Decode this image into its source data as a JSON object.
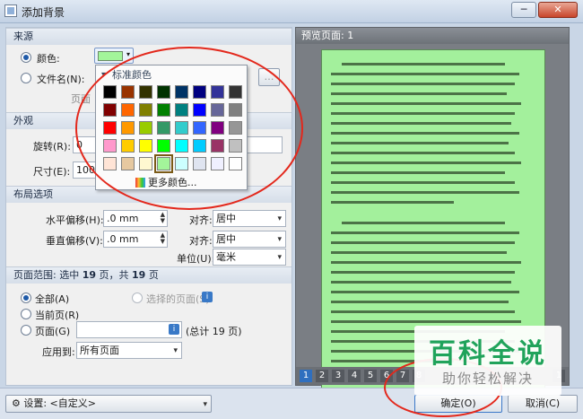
{
  "window": {
    "title": "添加背景",
    "minimize_label": "─",
    "close_label": "✕"
  },
  "source": {
    "header": "来源",
    "color_label": "颜色:",
    "file_label": "文件名(N):",
    "page_label_partial": "页面",
    "selected_color": "#a3f59a"
  },
  "appearance": {
    "header": "外观",
    "rotation_label": "旋转(R):",
    "rotation_value": "0",
    "size_label": "尺寸(E):",
    "size_value": "100%"
  },
  "layout": {
    "header": "布局选项",
    "h_offset_label": "水平偏移(H):",
    "h_offset_value": ".0 mm",
    "v_offset_label": "垂直偏移(V):",
    "v_offset_value": ".0 mm",
    "align_label": "对齐:",
    "h_align_value": "居中",
    "v_align_value": "居中",
    "unit_label": "单位(U):",
    "unit_value": "毫米"
  },
  "page_range": {
    "header_prefix": "页面范围: 选中",
    "selected_count": "19",
    "header_mid": "页，共",
    "total_count": "19",
    "header_suffix": "页",
    "all_label": "全部(A)",
    "selected_pages_label": "选择的页面(S)",
    "current_label": "当前页(R)",
    "pages_label": "页面(G)",
    "pages_value": "",
    "total_text": "(总计 19 页)",
    "apply_label": "应用到:",
    "apply_value": "所有页面"
  },
  "preview": {
    "header": "预览页面: 1",
    "page_numbers": [
      "1",
      "2",
      "3",
      "4",
      "5",
      "6",
      "7",
      "8"
    ],
    "last_page": "1"
  },
  "footer": {
    "settings_label": "设置: <自定义>",
    "ok_label": "确定(O)",
    "cancel_label": "取消(C)"
  },
  "palette": {
    "header": "标准颜色",
    "more_label": "更多颜色...",
    "rows": [
      [
        "#000000",
        "#993300",
        "#333300",
        "#003300",
        "#003366",
        "#000080",
        "#333399",
        "#333333"
      ],
      [
        "#800000",
        "#ff6600",
        "#808000",
        "#008000",
        "#008080",
        "#0000ff",
        "#666699",
        "#808080"
      ],
      [
        "#ff0000",
        "#ff9900",
        "#99cc00",
        "#339966",
        "#33cccc",
        "#3366ff",
        "#800080",
        "#969696"
      ],
      [
        "#ff99cc",
        "#ffcc00",
        "#ffff00",
        "#00ff00",
        "#00ffff",
        "#00ccff",
        "#993366",
        "#c0c0c0"
      ],
      [
        "#ffe4d6",
        "#e6c8a0",
        "#fff8d0",
        "#a3f59a",
        "#ccffff",
        "#dfe4f0",
        "#f0f0ff",
        "#ffffff"
      ]
    ],
    "selected_row": 4,
    "selected_col": 3
  },
  "watermark": {
    "line1": "百科全说",
    "line2": "助你轻松解决"
  }
}
